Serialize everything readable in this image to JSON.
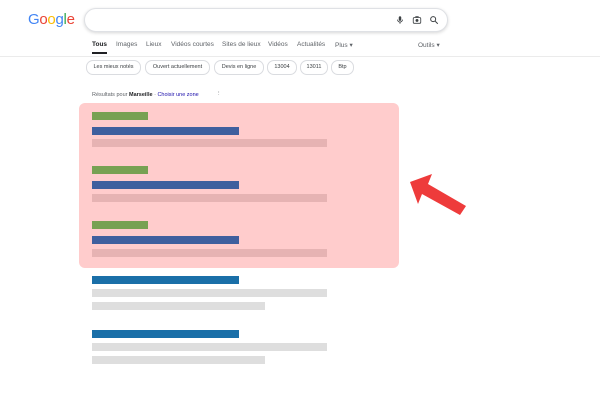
{
  "logo": {
    "letters": [
      "G",
      "o",
      "o",
      "g",
      "l",
      "e"
    ],
    "colors": [
      "#4285f4",
      "#ea4335",
      "#fbbc05",
      "#4285f4",
      "#34a853",
      "#ea4335"
    ]
  },
  "search": {
    "value": "",
    "placeholder": "",
    "icons": [
      "mic-icon",
      "camera-lens-icon",
      "search-icon"
    ]
  },
  "nav": {
    "tabs": [
      {
        "label": "Tous",
        "active": true
      },
      {
        "label": "Images"
      },
      {
        "label": "Lieux"
      },
      {
        "label": "Vidéos courtes"
      },
      {
        "label": "Sites de lieux"
      },
      {
        "label": "Vidéos"
      },
      {
        "label": "Actualités"
      },
      {
        "label": "Plus"
      }
    ],
    "tools_label": "Outils"
  },
  "chips": [
    "Les mieux notés",
    "Ouvert actuellement",
    "Devis en ligne",
    "13004",
    "13011",
    "Btp"
  ],
  "location": {
    "prefix": "Résultats pour ",
    "city": "Marseille",
    "separator": " · ",
    "link": "Choisir une zone",
    "kebab": "⋮"
  },
  "highlight_color": "#ffcccc",
  "arrow_color": "#ee3b3b"
}
